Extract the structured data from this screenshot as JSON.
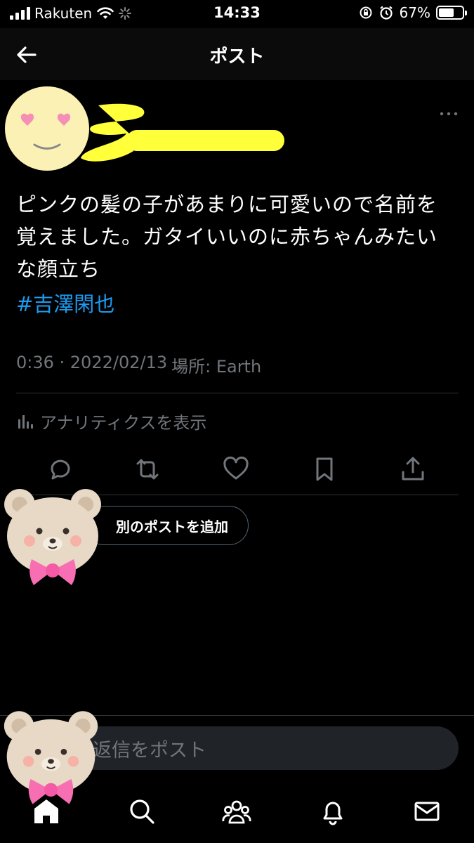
{
  "status_bar": {
    "carrier": "Rakuten",
    "time": "14:33",
    "battery_percent": "67%",
    "battery_level": 0.67
  },
  "header": {
    "title": "ポスト",
    "back_icon": "arrow-left-icon"
  },
  "post": {
    "text_lines": [
      "ピンクの髪の子があまりに可愛いので名前を",
      "覚えました。ガタイいいのに赤ちゃんみたい",
      "な顔立ち"
    ],
    "hashtag": "#吉澤閑也",
    "timestamp": "0:36 · 2022/02/13",
    "location": "場所: Earth",
    "analytics_label": "アナリティクスを表示",
    "actions": [
      "reply-icon",
      "repost-icon",
      "like-icon",
      "bookmark-icon",
      "share-icon"
    ]
  },
  "add_post_button": "別のポストを追加",
  "reply": {
    "placeholder": "返信をポスト"
  },
  "tabs": [
    "home-icon",
    "search-icon",
    "communities-icon",
    "notifications-icon",
    "messages-icon"
  ],
  "colors": {
    "background": "#000000",
    "link": "#1d9bf0",
    "muted": "#71767b",
    "scribble": "#ffff3a"
  }
}
